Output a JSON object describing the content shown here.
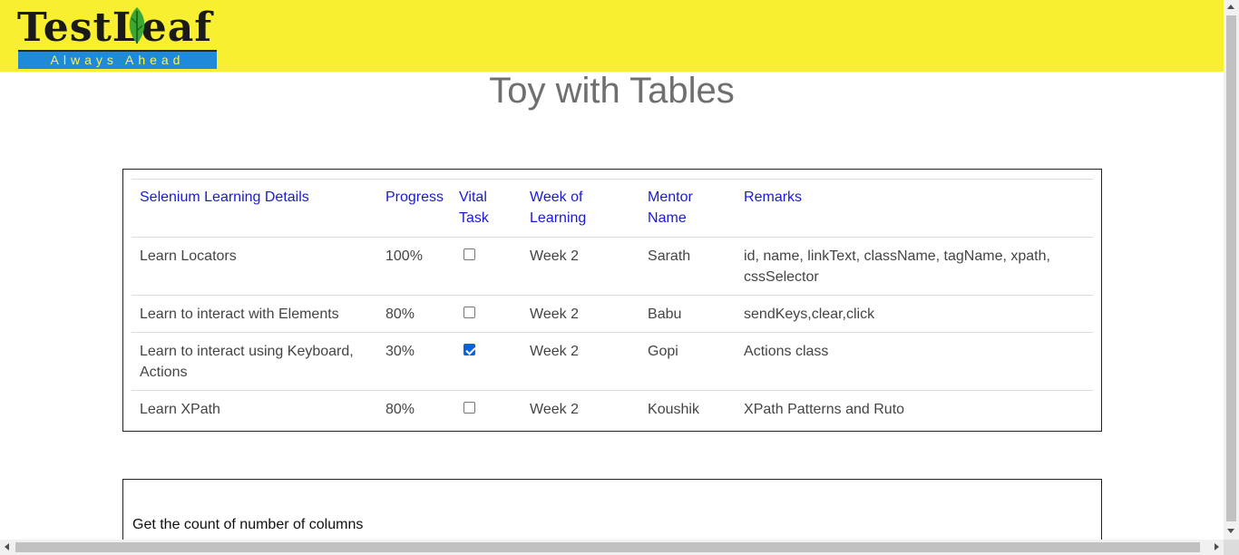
{
  "header": {
    "logo_text": "TestLeaf",
    "logo_tagline": "Always Ahead",
    "background_color": "#f8ef30"
  },
  "page": {
    "title": "Toy with Tables"
  },
  "table": {
    "headers": [
      "Selenium Learning Details",
      "Progress",
      "Vital Task",
      "Week of Learning",
      "Mentor Name",
      "Remarks"
    ],
    "rows": [
      {
        "details": "Learn Locators",
        "progress": "100%",
        "vital": false,
        "week": "Week 2",
        "mentor": "Sarath",
        "remarks": "id, name, linkText, className, tagName, xpath, cssSelector"
      },
      {
        "details": "Learn to interact with Elements",
        "progress": "80%",
        "vital": false,
        "week": "Week 2",
        "mentor": "Babu",
        "remarks": "sendKeys,clear,click"
      },
      {
        "details": "Learn to interact using Keyboard, Actions",
        "progress": "30%",
        "vital": true,
        "week": "Week 2",
        "mentor": "Gopi",
        "remarks": "Actions class"
      },
      {
        "details": "Learn XPath",
        "progress": "80%",
        "vital": false,
        "week": "Week 2",
        "mentor": "Koushik",
        "remarks": "XPath Patterns and Ruto"
      }
    ],
    "header_color": "#1a1ad6",
    "checkbox_checked_color": "#0b63d9"
  },
  "questions": {
    "q1": "Get the count of number of columns"
  }
}
